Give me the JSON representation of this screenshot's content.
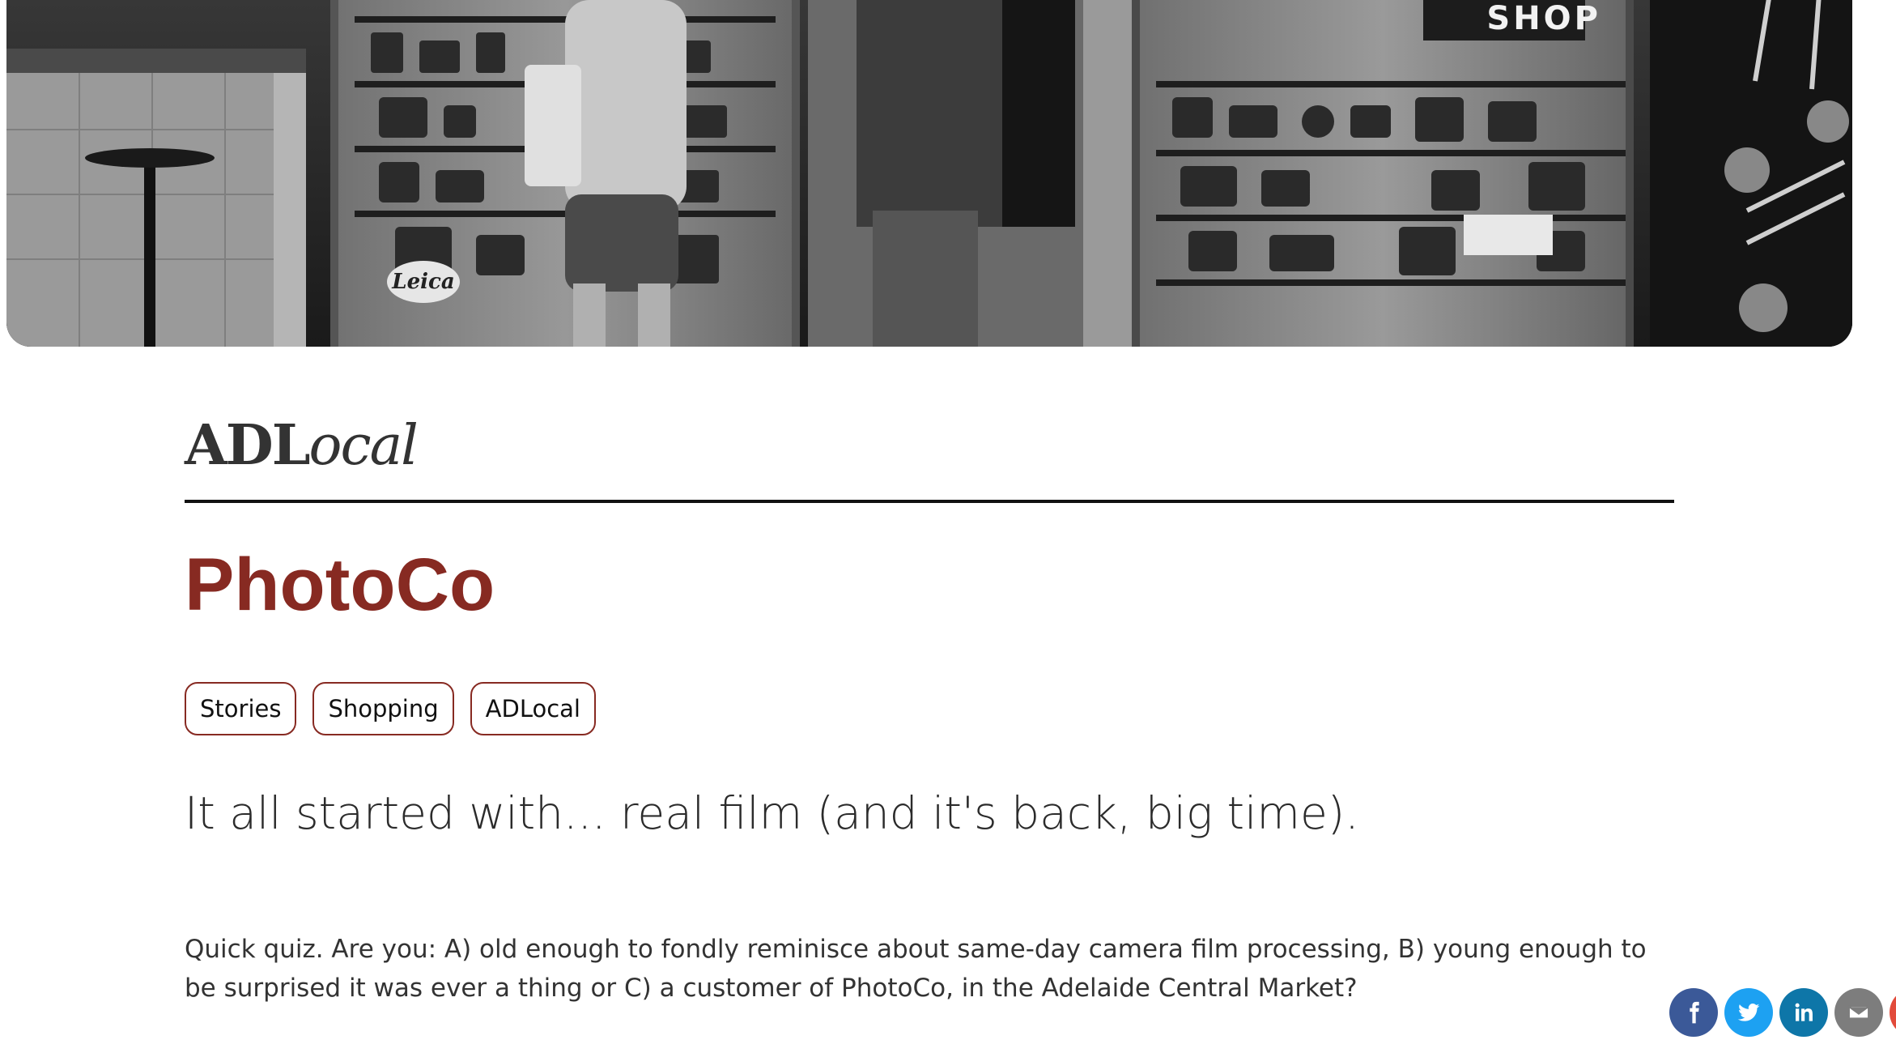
{
  "hero": {
    "sign_text": "SHOP",
    "leica_text": "Leica"
  },
  "brand": {
    "bold": "ADL",
    "italic": "ocal"
  },
  "article": {
    "title": "PhotoCo",
    "tags": [
      "Stories",
      "Shopping",
      "ADLocal"
    ],
    "subtitle": "It all started with... real film (and it's back, big time).",
    "body": "Quick quiz. Are you: A) old enough to fondly reminisce about same-day camera film processing, B) young enough to be surprised it was ever a thing or C) a customer of PhotoCo, in the Adelaide Central Market?"
  },
  "share": {
    "icons": [
      "facebook-icon",
      "twitter-icon",
      "linkedin-icon",
      "email-icon",
      "more-icon"
    ]
  },
  "colors": {
    "accent": "#872a22",
    "facebook": "#3b5998",
    "twitter": "#1da1f2",
    "linkedin": "#0e76a8",
    "email": "#7d7d7d",
    "more": "#e24b3b"
  }
}
